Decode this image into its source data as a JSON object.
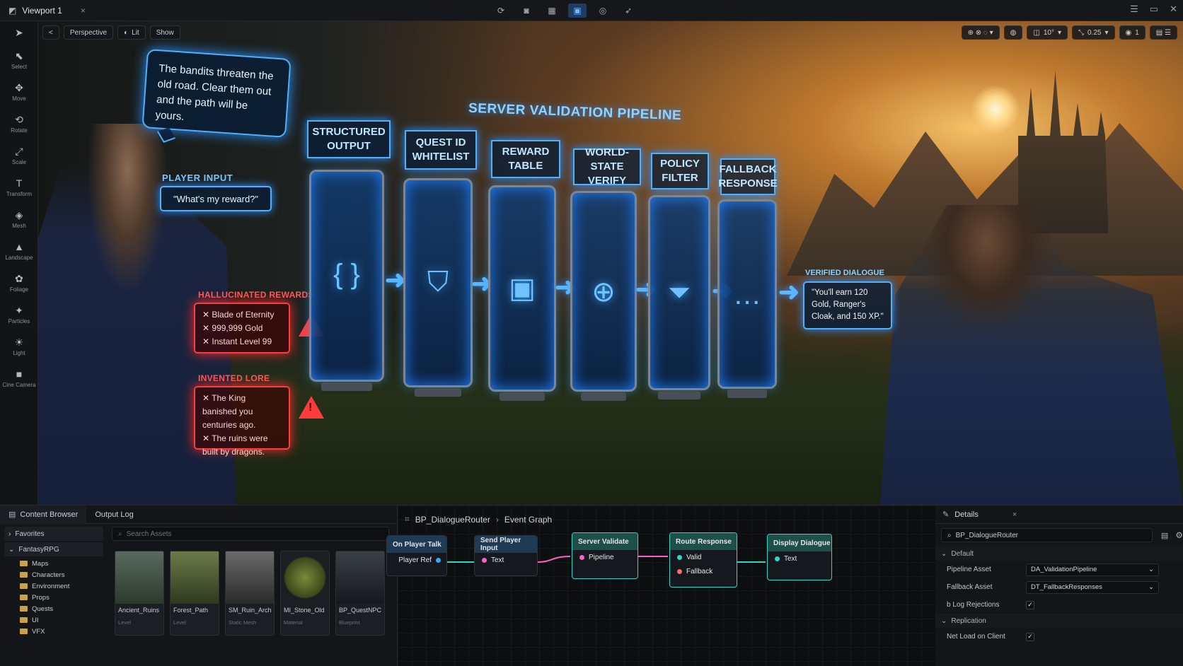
{
  "window": {
    "tab_title": "Viewport 1",
    "tab_close": "×",
    "controls": [
      "☰",
      "▭",
      "✕"
    ]
  },
  "left_toolbar": [
    {
      "label": "",
      "icon": "arrow-cursor-icon",
      "glyph": "➤"
    },
    {
      "label": "Select",
      "icon": "select-icon",
      "glyph": "⬉"
    },
    {
      "label": "Move",
      "icon": "move-icon",
      "glyph": "✥"
    },
    {
      "label": "Rotate",
      "icon": "rotate-icon",
      "glyph": "⟲"
    },
    {
      "label": "Scale",
      "icon": "scale-icon",
      "glyph": "⤢"
    },
    {
      "label": "Transform",
      "icon": "transform-icon",
      "glyph": "T"
    },
    {
      "label": "Mesh",
      "icon": "mesh-icon",
      "glyph": "◈"
    },
    {
      "label": "Landscape",
      "icon": "landscape-icon",
      "glyph": "▲"
    },
    {
      "label": "Foliage",
      "icon": "foliage-icon",
      "glyph": "✿"
    },
    {
      "label": "Particles",
      "icon": "particles-icon",
      "glyph": "✦"
    },
    {
      "label": "Light",
      "icon": "light-icon",
      "glyph": "☀"
    },
    {
      "label": "Cine Camera",
      "icon": "camera-icon",
      "glyph": "■"
    }
  ],
  "viewport_toolbar": {
    "back": "<",
    "perspective": "Perspective",
    "lit": "Lit",
    "show": "Show"
  },
  "viewport_right": {
    "angle_snap": "10°",
    "scale_snap": "0.25",
    "camera_speed": "1"
  },
  "scene": {
    "npc_speech": "The bandits threaten the old road. Clear them out and the path will be yours.",
    "player_input_label": "PLAYER INPUT",
    "player_input_text": "\"What's my reward?\"",
    "hallucinated_label": "HALLUCINATED REWARDS",
    "hallucinated_items": [
      "Blade of Eternity",
      "999,999 Gold",
      "Instant Level 99"
    ],
    "invented_label": "INVENTED LORE",
    "invented_items": [
      "The King banished you centuries ago.",
      "The ruins were built by dragons."
    ],
    "pipeline_title": "SERVER VALIDATION PIPELINE",
    "stages": [
      {
        "label": "STRUCTURED OUTPUT",
        "icon": "braces-icon",
        "glyph": "{ }"
      },
      {
        "label": "QUEST ID WHITELIST",
        "icon": "shield-check-icon",
        "glyph": "⛉"
      },
      {
        "label": "REWARD TABLE",
        "icon": "treasure-chest-icon",
        "glyph": "▣"
      },
      {
        "label": "WORLD-STATE VERIFY",
        "icon": "globe-icon",
        "glyph": "⊕"
      },
      {
        "label": "POLICY FILTER",
        "icon": "funnel-icon",
        "glyph": "⏷"
      },
      {
        "label": "FALLBACK RESPONSE",
        "icon": "chat-bubble-icon",
        "glyph": "…"
      }
    ],
    "verified_label": "VERIFIED DIALOGUE",
    "verified_text": "\"You'll earn 120 Gold, Ranger's Cloak, and 150 XP.\""
  },
  "content_browser": {
    "tab_label": "Content Browser",
    "output_tab": "Output Log",
    "favorites": "Favorites",
    "project": "FantasyRPG",
    "folders": [
      "Maps",
      "Characters",
      "Environment",
      "Props",
      "Quests",
      "UI",
      "VFX"
    ],
    "search_placeholder": "Search Assets",
    "assets": [
      {
        "name": "Ancient_Ruins",
        "type": "Level"
      },
      {
        "name": "Forest_Path",
        "type": "Level"
      },
      {
        "name": "SM_Ruin_Arch",
        "type": "Static Mesh"
      },
      {
        "name": "MI_Stone_Old",
        "type": "Material"
      },
      {
        "name": "BP_QuestNPC",
        "type": "Blueprint"
      }
    ]
  },
  "graph": {
    "breadcrumb": [
      "BP_DialogueRouter",
      "Event Graph"
    ],
    "nodes": [
      {
        "title": "On Player Talk",
        "pins": [
          "Player Ref"
        ]
      },
      {
        "title": "Send Player Input",
        "pins": [
          "Text"
        ]
      },
      {
        "title": "Server Validate",
        "pins": [
          "Pipeline"
        ]
      },
      {
        "title": "Route Response",
        "pins": [
          "Valid",
          "Fallback"
        ]
      },
      {
        "title": "Display Dialogue",
        "pins": [
          "Text"
        ]
      }
    ]
  },
  "details": {
    "tab_label": "Details",
    "search_value": "BP_DialogueRouter",
    "section_default": "Default",
    "pipeline_asset_label": "Pipeline Asset",
    "pipeline_asset_value": "DA_ValidationPipeline",
    "fallback_asset_label": "Fallback Asset",
    "fallback_asset_value": "DT_FallbackResponses",
    "log_rejections_label": "b Log Rejections",
    "log_rejections_checked": true,
    "section_replication": "Replication",
    "net_load_label": "Net Load on Client",
    "net_load_checked": true
  },
  "colors": {
    "accent_blue": "#4cb2ff",
    "error_red": "#ff3b3b",
    "exec_teal": "#2fd6c8",
    "data_pink": "#ff5fc6"
  }
}
